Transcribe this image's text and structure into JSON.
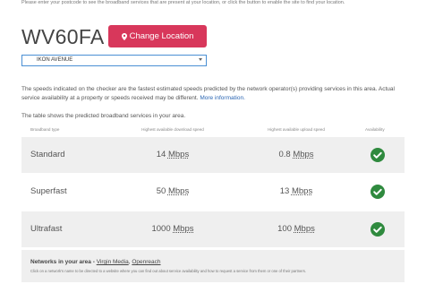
{
  "intro_text": "Please enter your postcode to see the broadband services that are present at your location, or click the button to enable the site to find your location.",
  "postcode": "WV60FA",
  "change_location_button": "Change Location",
  "address_select": {
    "selected": "IKON AVENUE"
  },
  "disclaimer": {
    "text": "The speeds indicated on the checker are the fastest estimated speeds predicted by the network operator(s) providing services in this area. Actual service availability at a property or speeds received may be different.",
    "link": "More information."
  },
  "table_intro": "The table shows the predicted broadband services in your area.",
  "columns": {
    "type": "Broadband type",
    "download": "Highest available download speed",
    "upload": "Highest available upload speed",
    "availability": "Availability"
  },
  "rows": [
    {
      "type": "Standard",
      "download": "14",
      "download_unit": "Mbps",
      "upload": "0.8",
      "upload_unit": "Mbps",
      "available": true
    },
    {
      "type": "Superfast",
      "download": "50",
      "download_unit": "Mbps",
      "upload": "13",
      "upload_unit": "Mbps",
      "available": true
    },
    {
      "type": "Ultrafast",
      "download": "1000",
      "download_unit": "Mbps",
      "upload": "100",
      "upload_unit": "Mbps",
      "available": true
    }
  ],
  "networks": {
    "label": "Networks in your area",
    "separator": " - ",
    "items": [
      "Virgin Media",
      "Openreach"
    ],
    "footnote": "Click on a network's name to be directed to a website where you can find out about service availability and how to request a service from them or one of their partners."
  },
  "colors": {
    "accent": "#d8375b",
    "check": "#2f8a3e",
    "link": "#2b66b3",
    "select_border": "#4a8fd4"
  },
  "icons": {
    "button": "map-marker-icon",
    "availability": "check-circle-icon",
    "select": "caret-down-icon"
  }
}
